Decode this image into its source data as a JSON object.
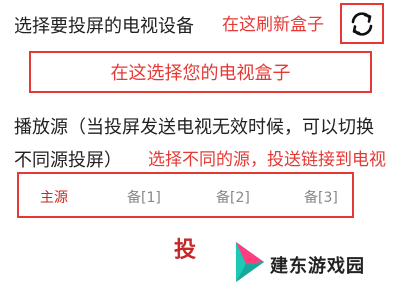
{
  "header": {
    "title": "选择要投屏的电视设备",
    "refresh_annotation": "在这刷新盒子"
  },
  "device_select": {
    "placeholder": "在这选择您的电视盒子"
  },
  "sources": {
    "description": "播放源（当投屏发送电视无效时候，可以切换不同源投屏）",
    "annotation": "选择不同的源，投送链接到电视",
    "tabs": [
      {
        "label": "主源",
        "active": true
      },
      {
        "label": "备[1]",
        "active": false
      },
      {
        "label": "备[2]",
        "active": false
      },
      {
        "label": "备[3]",
        "active": false
      }
    ]
  },
  "cast_button": {
    "label": "投"
  },
  "watermark": {
    "text": "建东游戏园"
  },
  "colors": {
    "accent_red": "#e53935",
    "active_tab": "#c62828",
    "inactive_tab": "#888888"
  }
}
